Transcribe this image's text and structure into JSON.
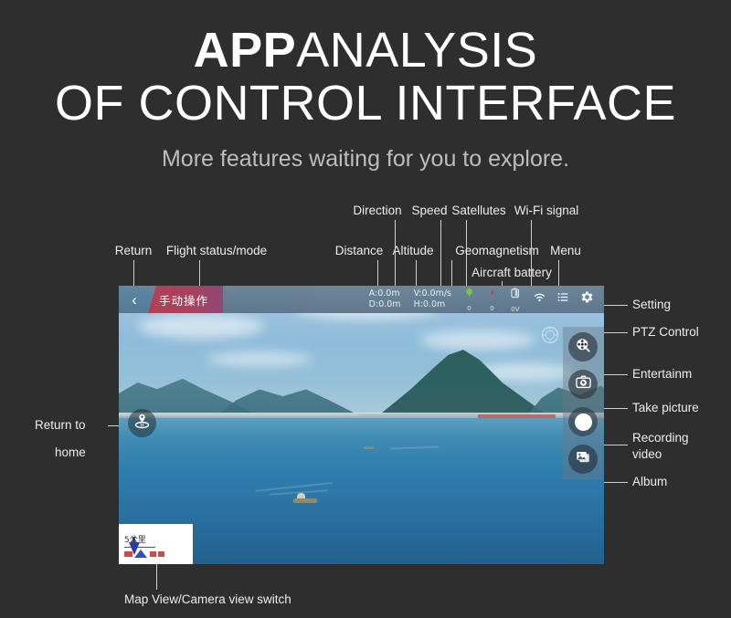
{
  "header": {
    "title_bold": "APP",
    "title_rest": "ANALYSIS",
    "title_line2": "OF CONTROL INTERFACE",
    "subtitle": "More features waiting for you to explore."
  },
  "annotations": {
    "top": [
      {
        "label": "Return"
      },
      {
        "label": "Flight status/mode"
      },
      {
        "label": "Distance"
      },
      {
        "label": "Altitude"
      },
      {
        "label": "Direction"
      },
      {
        "label": "Speed"
      },
      {
        "label": "Satellutes"
      },
      {
        "label": "Geomagnetism"
      },
      {
        "label": "Aircraft battery"
      },
      {
        "label": "Wi-Fi signal"
      },
      {
        "label": "Menu"
      }
    ],
    "right": [
      {
        "label": "Setting"
      },
      {
        "label": "PTZ Control"
      },
      {
        "label": "Entertainm"
      },
      {
        "label": "Take picture"
      },
      {
        "label": "Recording video"
      },
      {
        "label": "Album"
      }
    ],
    "left": [
      {
        "label_line1": "Return  to",
        "label_line2": "home"
      }
    ],
    "bottom": [
      {
        "label": "Map View/Camera view switch"
      }
    ]
  },
  "app": {
    "back_chevron": "‹",
    "flight_mode": "手动操作",
    "telemetry": {
      "altitude": "A:0.0m",
      "distance": "D:0.0m",
      "vertical_speed": "V:0.0m/s",
      "horizontal_speed": "H:0.0m"
    },
    "status": {
      "satellites": "0",
      "geomagnetism": "0",
      "battery_voltage": "0V"
    },
    "icons": {
      "satellite": "satellite-icon",
      "geomagnetism": "compass-icon",
      "battery": "battery-icon",
      "wifi": "wifi-icon",
      "menu": "menu-icon",
      "settings": "gear-icon",
      "ptz": "ptz-control-icon",
      "return_home": "return-to-home-icon",
      "entertainment": "film-reel-icon",
      "take_picture": "camera-icon",
      "record": "record-icon",
      "album": "album-icon"
    },
    "minimap": {
      "scale_label": "5公里"
    }
  },
  "colors": {
    "page_background": "#2e2e2e",
    "title_text": "#ffffff",
    "subtitle_text": "#bdbdbd",
    "annotation_text": "#ededed",
    "connector_line": "#cfcfcf",
    "mode_banner_start": "#b33f55",
    "mode_banner_end": "#8d4a76",
    "statusbar": "#687a8c",
    "satellite_green": "#7ec14a",
    "geomagnetism_red": "#d0394b"
  }
}
